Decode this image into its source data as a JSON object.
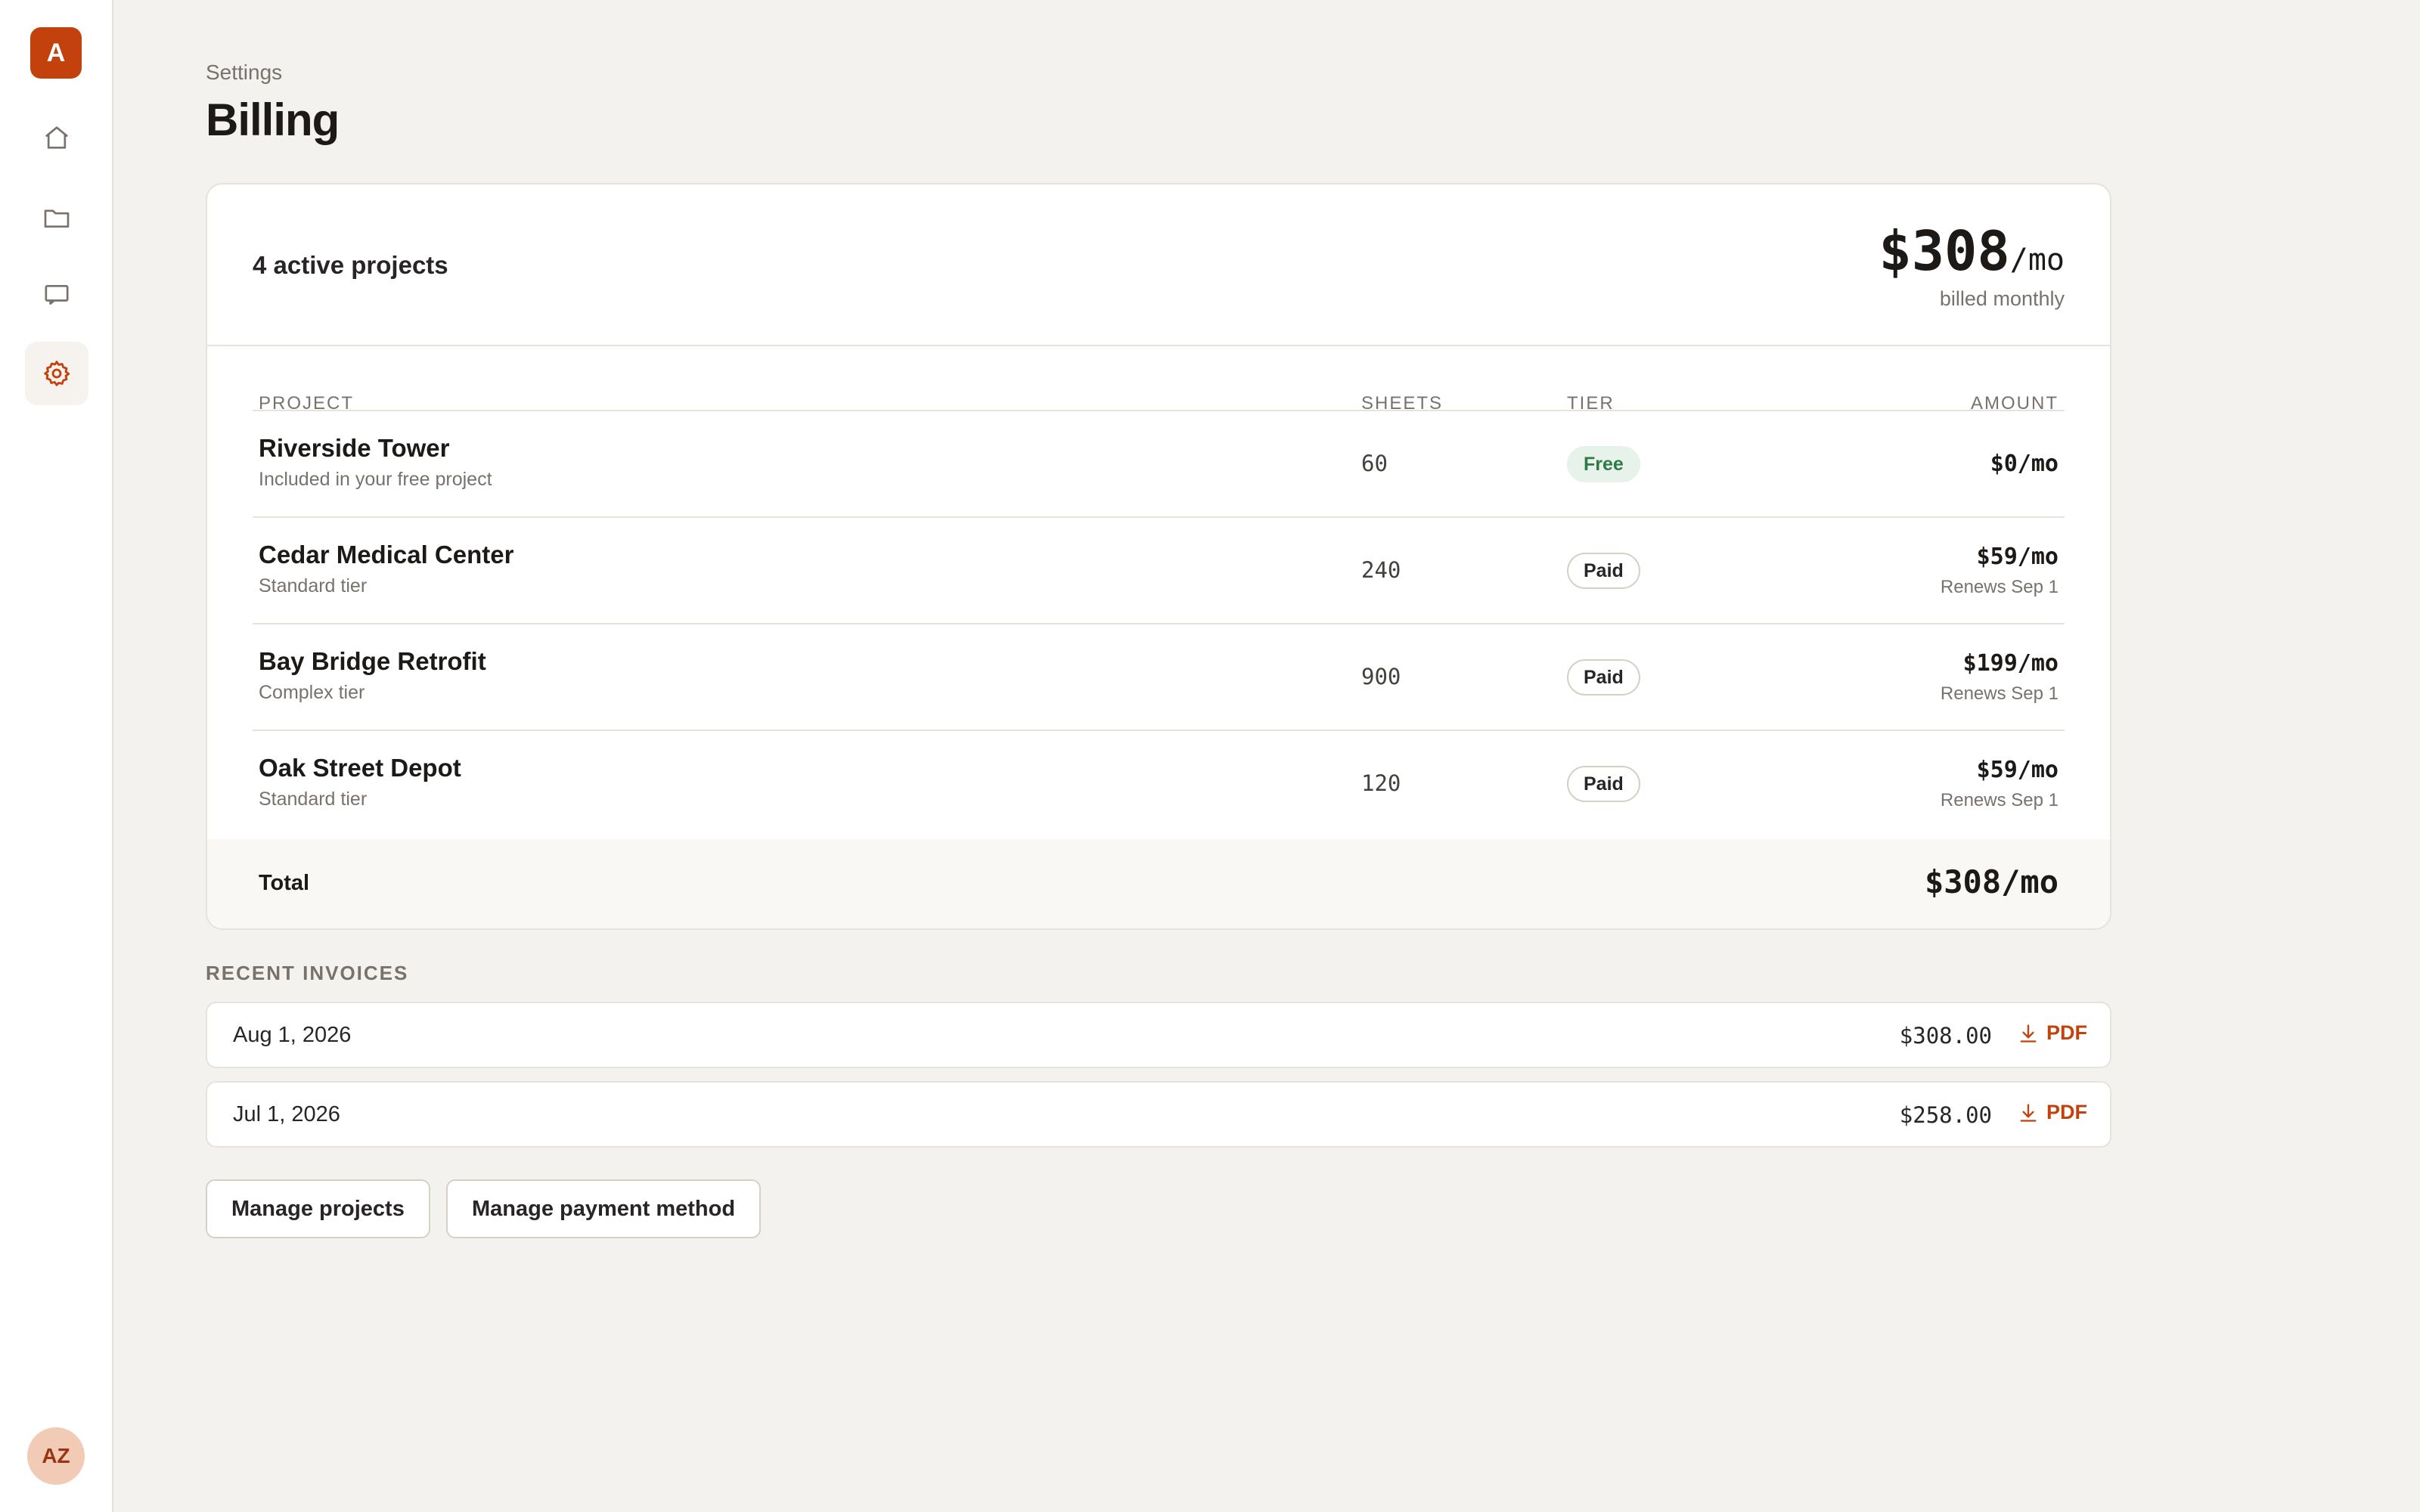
{
  "app": {
    "logo_letter": "A",
    "user_initials": "AZ"
  },
  "sidebar": {
    "items": [
      {
        "icon": "home-icon"
      },
      {
        "icon": "folder-icon"
      },
      {
        "icon": "inbox-icon"
      },
      {
        "icon": "gear-icon",
        "active": true
      }
    ]
  },
  "header": {
    "breadcrumb": "Settings",
    "title": "Billing"
  },
  "summary": {
    "active_projects": "4 active projects",
    "price": "$308",
    "price_suffix": "/mo",
    "billing_cycle": "billed monthly"
  },
  "table": {
    "columns": [
      "PROJECT",
      "SHEETS",
      "TIER",
      "AMOUNT"
    ],
    "rows": [
      {
        "name": "Riverside Tower",
        "subtitle": "Included in your free project",
        "sheets": "60",
        "tier": "Free",
        "amount": "$0/mo",
        "renews": ""
      },
      {
        "name": "Cedar Medical Center",
        "subtitle": "Standard tier",
        "sheets": "240",
        "tier": "Paid",
        "amount": "$59/mo",
        "renews": "Renews Sep 1"
      },
      {
        "name": "Bay Bridge Retrofit",
        "subtitle": "Complex tier",
        "sheets": "900",
        "tier": "Paid",
        "amount": "$199/mo",
        "renews": "Renews Sep 1"
      },
      {
        "name": "Oak Street Depot",
        "subtitle": "Standard tier",
        "sheets": "120",
        "tier": "Paid",
        "amount": "$59/mo",
        "renews": "Renews Sep 1"
      }
    ],
    "total_label": "Total",
    "total_amount": "$308/mo"
  },
  "invoices": {
    "section_label": "RECENT INVOICES",
    "items": [
      {
        "date": "Aug 1, 2026",
        "amount": "$308.00",
        "link": "PDF"
      },
      {
        "date": "Jul 1, 2026",
        "amount": "$258.00",
        "link": "PDF"
      }
    ]
  },
  "actions": {
    "manage_projects": "Manage projects",
    "manage_payment": "Manage payment method"
  },
  "colors": {
    "accent": "#c2410c",
    "background": "#f4f2ee",
    "free_badge": "#2f7a46"
  }
}
